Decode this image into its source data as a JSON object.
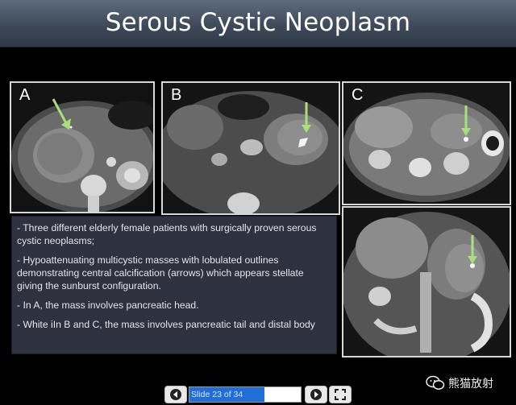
{
  "slide": {
    "title": "Serous Cystic Neoplasm",
    "panels": [
      {
        "label": "A",
        "icon": "ct-scan-axial-image"
      },
      {
        "label": "B",
        "icon": "ct-scan-axial-image"
      },
      {
        "label": "C",
        "icon": "ct-scan-axial-image"
      },
      {
        "label": "",
        "icon": "ct-scan-coronal-image"
      }
    ],
    "bullets": [
      "- Three different  elderly female patients with surgically proven serous cystic neoplasms;",
      "- Hypoattenuating multicystic masses with lobulated outlines demonstrating central calcification (arrows) which appears stellate giving the sunburst configuration.",
      "- In A, the mass involves pancreatic head.",
      "- White iIn B and C, the mass involves pancreatic tail and distal body"
    ]
  },
  "player": {
    "slide_counter": "Slide 23 of 34",
    "progress": 0.676,
    "prev_icon": "arrow-left-icon",
    "next_icon": "arrow-right-icon",
    "fullscreen_icon": "fullscreen-icon",
    "accent_color": "#1f6fd6"
  },
  "watermark": {
    "text": "熊猫放射",
    "icon": "wechat-icon"
  }
}
